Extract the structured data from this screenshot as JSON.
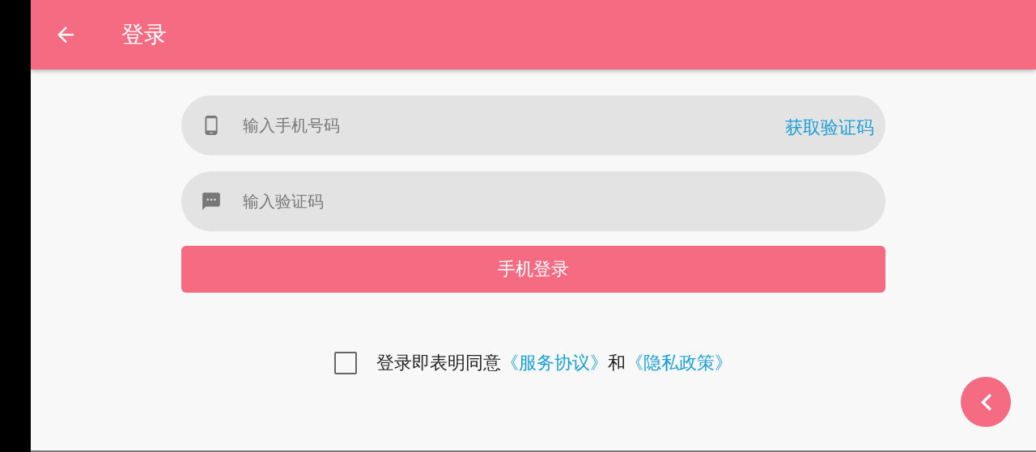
{
  "header": {
    "title": "登录"
  },
  "phone_field": {
    "placeholder": "输入手机号码",
    "action": "获取验证码"
  },
  "code_field": {
    "placeholder": "输入验证码"
  },
  "login_button": {
    "label": "手机登录"
  },
  "agreement": {
    "checked": false,
    "text": "登录即表明同意",
    "link_1": "《服务协议》",
    "connector": "和",
    "link_2": "《隐私政策》"
  }
}
